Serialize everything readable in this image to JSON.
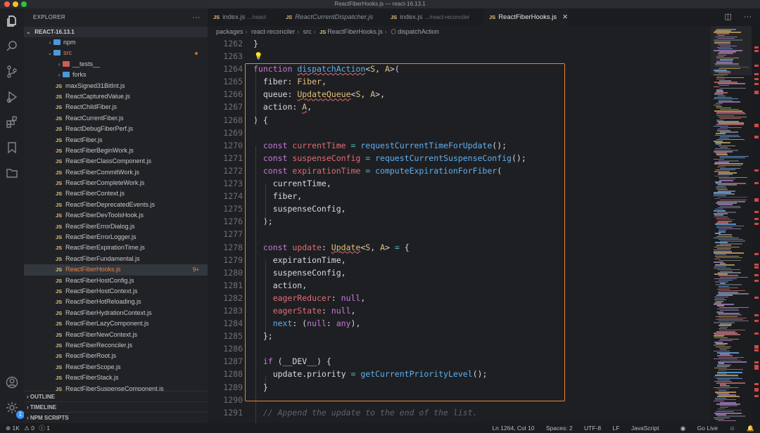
{
  "window": {
    "title": "ReactFiberHooks.js — react-16.13.1"
  },
  "activity_bar": {
    "settings_badge": "1"
  },
  "sidebar": {
    "header": "EXPLORER",
    "project": "REACT-16.13.1",
    "tree": [
      {
        "label": "npm",
        "kind": "folder",
        "indent": 1,
        "chev": "›",
        "folder_color": "#4e97d8"
      },
      {
        "label": "src",
        "kind": "folder-open",
        "indent": 1,
        "chev": "⌄",
        "folder_color": "#4e97d8",
        "orange": true,
        "dot": true
      },
      {
        "label": "__tests__",
        "kind": "folder",
        "indent": 2,
        "chev": "›",
        "folder_color": "#d05a5a"
      },
      {
        "label": "forks",
        "kind": "folder",
        "indent": 2,
        "chev": "›",
        "folder_color": "#4e97d8"
      },
      {
        "label": "maxSigned31BitInt.js",
        "kind": "js",
        "indent": 2
      },
      {
        "label": "ReactCapturedValue.js",
        "kind": "js",
        "indent": 2
      },
      {
        "label": "ReactChildFiber.js",
        "kind": "js",
        "indent": 2
      },
      {
        "label": "ReactCurrentFiber.js",
        "kind": "js",
        "indent": 2
      },
      {
        "label": "ReactDebugFiberPerf.js",
        "kind": "js",
        "indent": 2
      },
      {
        "label": "ReactFiber.js",
        "kind": "js",
        "indent": 2
      },
      {
        "label": "ReactFiberBeginWork.js",
        "kind": "js",
        "indent": 2
      },
      {
        "label": "ReactFiberClassComponent.js",
        "kind": "js",
        "indent": 2
      },
      {
        "label": "ReactFiberCommitWork.js",
        "kind": "js",
        "indent": 2
      },
      {
        "label": "ReactFiberCompleteWork.js",
        "kind": "js",
        "indent": 2
      },
      {
        "label": "ReactFiberContext.js",
        "kind": "js",
        "indent": 2
      },
      {
        "label": "ReactFiberDeprecatedEvents.js",
        "kind": "js",
        "indent": 2
      },
      {
        "label": "ReactFiberDevToolsHook.js",
        "kind": "js",
        "indent": 2
      },
      {
        "label": "ReactFiberErrorDialog.js",
        "kind": "js",
        "indent": 2
      },
      {
        "label": "ReactFiberErrorLogger.js",
        "kind": "js",
        "indent": 2
      },
      {
        "label": "ReactFiberExpirationTime.js",
        "kind": "js",
        "indent": 2
      },
      {
        "label": "ReactFiberFundamental.js",
        "kind": "js",
        "indent": 2
      },
      {
        "label": "ReactFiberHooks.js",
        "kind": "js",
        "indent": 2,
        "selected": true,
        "orange": true,
        "decoration": "9+"
      },
      {
        "label": "ReactFiberHostConfig.js",
        "kind": "js",
        "indent": 2
      },
      {
        "label": "ReactFiberHostContext.js",
        "kind": "js",
        "indent": 2
      },
      {
        "label": "ReactFiberHotReloading.js",
        "kind": "js",
        "indent": 2
      },
      {
        "label": "ReactFiberHydrationContext.js",
        "kind": "js",
        "indent": 2
      },
      {
        "label": "ReactFiberLazyComponent.js",
        "kind": "js",
        "indent": 2
      },
      {
        "label": "ReactFiberNewContext.js",
        "kind": "js",
        "indent": 2
      },
      {
        "label": "ReactFiberReconciler.js",
        "kind": "js",
        "indent": 2
      },
      {
        "label": "ReactFiberRoot.js",
        "kind": "js",
        "indent": 2
      },
      {
        "label": "ReactFiberScope.js",
        "kind": "js",
        "indent": 2
      },
      {
        "label": "ReactFiberStack.js",
        "kind": "js",
        "indent": 2
      },
      {
        "label": "ReactFiberSuspenseComponent.js",
        "kind": "js",
        "indent": 2
      }
    ],
    "panels": [
      "OUTLINE",
      "TIMELINE",
      "NPM SCRIPTS"
    ]
  },
  "tabs": [
    {
      "label": "index.js",
      "desc": ".../react",
      "active": false
    },
    {
      "label": "ReactCurrentDispatcher.js",
      "desc": "",
      "active": false,
      "italic": true
    },
    {
      "label": "index.js",
      "desc": ".../react-reconciler",
      "active": false
    },
    {
      "label": "ReactFiberHooks.js",
      "desc": "",
      "active": true
    }
  ],
  "breadcrumb": [
    "packages",
    "react-reconciler",
    "src",
    "ReactFiberHooks.js",
    "dispatchAction"
  ],
  "editor": {
    "line_numbers": [
      "1262",
      "1263",
      "1264",
      "1265",
      "1266",
      "1267",
      "1268",
      "1269",
      "1270",
      "1271",
      "1272",
      "1273",
      "1274",
      "1275",
      "1276",
      "1277",
      "1278",
      "1279",
      "1280",
      "1281",
      "1282",
      "1283",
      "1284",
      "1285",
      "1286",
      "1287",
      "1288",
      "1289",
      "1290",
      "1291"
    ],
    "lines": [
      [
        [
          "}",
          "pn"
        ]
      ],
      [],
      [
        [
          "function ",
          "kw"
        ],
        [
          "dispatchAction",
          "fn sq"
        ],
        [
          "<",
          "pn"
        ],
        [
          "S",
          "ty"
        ],
        [
          ", ",
          "pn"
        ],
        [
          "A",
          "ty"
        ],
        [
          ">(",
          "pn"
        ]
      ],
      [
        [
          "  fiber",
          "pn"
        ],
        [
          ": ",
          "pn"
        ],
        [
          "Fiber",
          "ty"
        ],
        [
          ",",
          "pn"
        ]
      ],
      [
        [
          "  queue",
          "pn"
        ],
        [
          ": ",
          "pn"
        ],
        [
          "UpdateQueue",
          "ty sq"
        ],
        [
          "<",
          "pn"
        ],
        [
          "S",
          "ty"
        ],
        [
          ", ",
          "pn"
        ],
        [
          "A",
          "ty"
        ],
        [
          ">,",
          "pn"
        ]
      ],
      [
        [
          "  action",
          "pn"
        ],
        [
          ": ",
          "pn"
        ],
        [
          "A",
          "ty sq"
        ],
        [
          ",",
          "pn"
        ]
      ],
      [
        [
          ") {",
          "pn"
        ]
      ],
      [],
      [
        [
          "  const ",
          "kw"
        ],
        [
          "currentTime",
          "pr"
        ],
        [
          " = ",
          "op"
        ],
        [
          "requestCurrentTimeForUpdate",
          "fn"
        ],
        [
          "();",
          "pn"
        ]
      ],
      [
        [
          "  const ",
          "kw"
        ],
        [
          "suspenseConfig",
          "pr"
        ],
        [
          " = ",
          "op"
        ],
        [
          "requestCurrentSuspenseConfig",
          "fn"
        ],
        [
          "();",
          "pn"
        ]
      ],
      [
        [
          "  const ",
          "kw"
        ],
        [
          "expirationTime",
          "pr"
        ],
        [
          " = ",
          "op"
        ],
        [
          "computeExpirationForFiber",
          "fn"
        ],
        [
          "(",
          "pn"
        ]
      ],
      [
        [
          "    currentTime,",
          "pn"
        ]
      ],
      [
        [
          "    fiber,",
          "pn"
        ]
      ],
      [
        [
          "    suspenseConfig,",
          "pn"
        ]
      ],
      [
        [
          "  );",
          "pn"
        ]
      ],
      [],
      [
        [
          "  const ",
          "kw"
        ],
        [
          "update",
          "pr"
        ],
        [
          ": ",
          "pn"
        ],
        [
          "Update",
          "ty sq"
        ],
        [
          "<",
          "pn"
        ],
        [
          "S",
          "ty"
        ],
        [
          ", ",
          "pn"
        ],
        [
          "A",
          "ty"
        ],
        [
          "> ",
          "pn"
        ],
        [
          "=",
          "op"
        ],
        [
          " {",
          "pn"
        ]
      ],
      [
        [
          "    expirationTime,",
          "pn"
        ]
      ],
      [
        [
          "    suspenseConfig,",
          "pn"
        ]
      ],
      [
        [
          "    action,",
          "pn"
        ]
      ],
      [
        [
          "    eagerReducer",
          "pr"
        ],
        [
          ": ",
          "pn"
        ],
        [
          "null",
          "kw"
        ],
        [
          ",",
          "pn"
        ]
      ],
      [
        [
          "    eagerState",
          "pr"
        ],
        [
          ": ",
          "pn"
        ],
        [
          "null",
          "kw"
        ],
        [
          ",",
          "pn"
        ]
      ],
      [
        [
          "    next",
          "fn"
        ],
        [
          ": (",
          "pn"
        ],
        [
          "null",
          "kw"
        ],
        [
          ": ",
          "pn"
        ],
        [
          "any",
          "kw"
        ],
        [
          "),",
          "pn"
        ]
      ],
      [
        [
          "  };",
          "pn"
        ]
      ],
      [],
      [
        [
          "  if ",
          "kw"
        ],
        [
          "(__DEV__) {",
          "pn"
        ]
      ],
      [
        [
          "    update.priority ",
          "pn"
        ],
        [
          "= ",
          "op"
        ],
        [
          "getCurrentPriorityLevel",
          "fn"
        ],
        [
          "();",
          "pn"
        ]
      ],
      [
        [
          "  }",
          "pn"
        ]
      ],
      [],
      [
        [
          "  // Append the update to the end of the list.",
          "cm"
        ]
      ]
    ]
  },
  "statusbar": {
    "errors": "1K",
    "warnings": "0",
    "info": "1",
    "position": "Ln 1264, Col 10",
    "spaces": "Spaces: 2",
    "encoding": "UTF-8",
    "eol": "LF",
    "language": "JavaScript",
    "golive": "Go Live"
  },
  "colors": {
    "highlight_border": "#e8872e",
    "accent": "#3794ff"
  }
}
